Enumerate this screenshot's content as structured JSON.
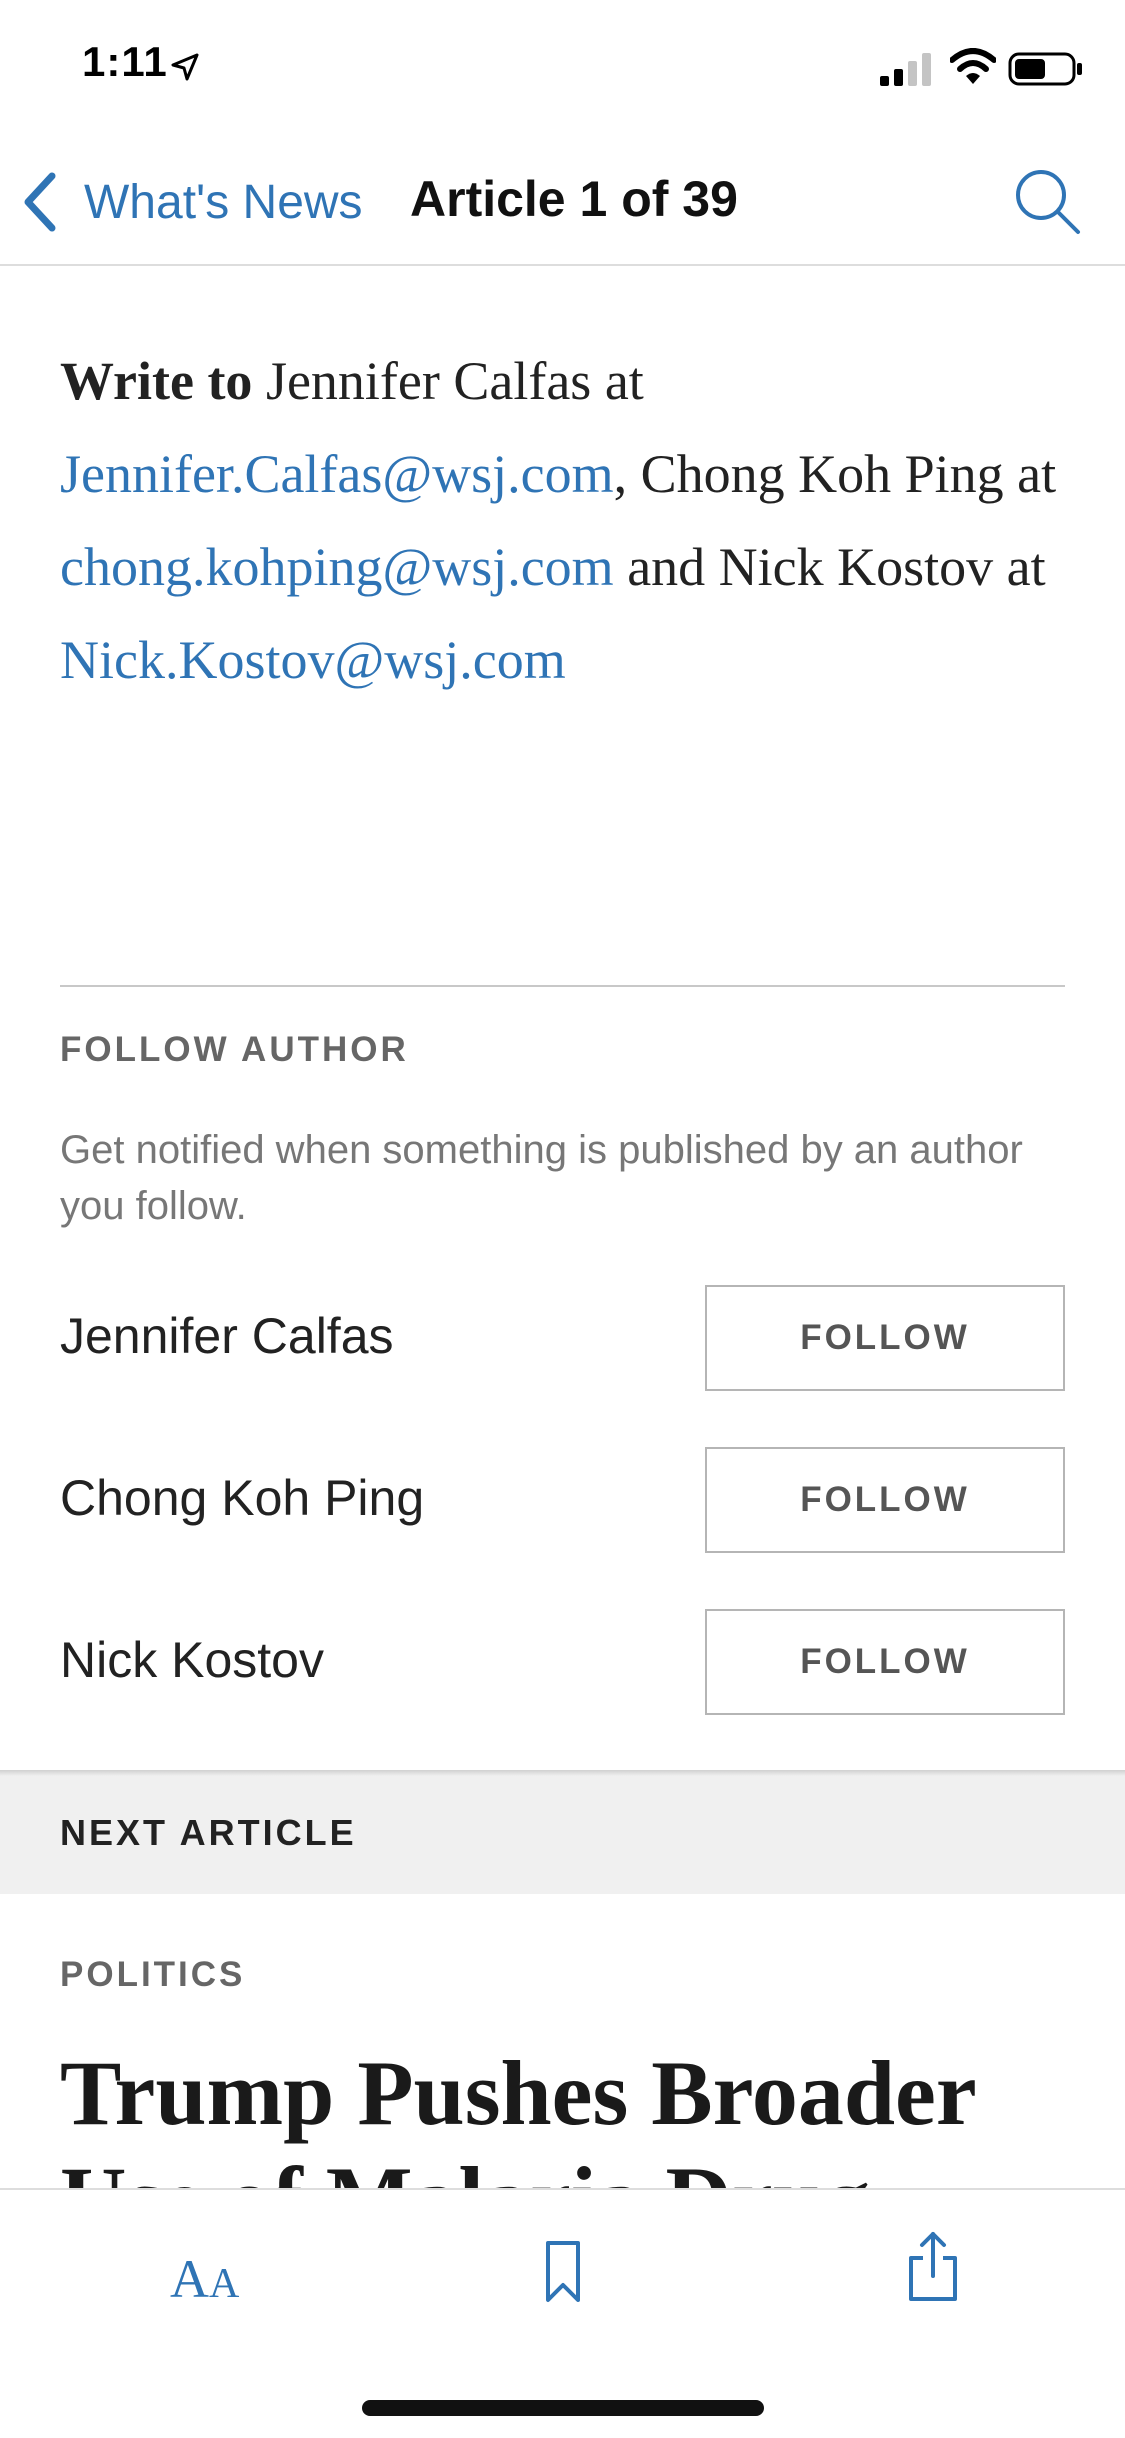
{
  "status_bar": {
    "time": "1:11",
    "icons": [
      "location-arrow-icon",
      "cellular-signal-icon",
      "wifi-icon",
      "battery-icon"
    ]
  },
  "nav": {
    "back_label": "What's News",
    "title": "Article 1 of 39",
    "icons": [
      "back-chevron-icon",
      "search-icon"
    ]
  },
  "write_to": {
    "lead": "Write to",
    "name1": "Jennifer Calfas",
    "at1": "at",
    "email1": "Jennifer.Calfas@wsj.com",
    "sep": ",",
    "name2": "Chong Koh Ping",
    "at2": "at",
    "email2": "chong.kohping@wsj.com",
    "and": "and",
    "name3": "Nick Kostov",
    "at3": "at",
    "email3": "Nick.Kostov@wsj.com"
  },
  "follow": {
    "heading": "FOLLOW AUTHOR",
    "description": "Get notified when something is published by an author you follow.",
    "authors": [
      {
        "name": "Jennifer Calfas",
        "button": "FOLLOW"
      },
      {
        "name": "Chong Koh Ping",
        "button": "FOLLOW"
      },
      {
        "name": "Nick Kostov",
        "button": "FOLLOW"
      }
    ]
  },
  "next_article": {
    "label": "NEXT ARTICLE",
    "category": "POLITICS",
    "headline": "Trump Pushes Broader Use of Malaria Drug"
  },
  "toolbar": {
    "text_size_big": "A",
    "text_size_small": "A",
    "icons": [
      "text-size-icon",
      "bookmark-icon",
      "share-icon"
    ]
  },
  "colors": {
    "link": "#2f74b5",
    "text": "#222222",
    "muted": "#666666",
    "section_bg": "#f0f0f0"
  }
}
